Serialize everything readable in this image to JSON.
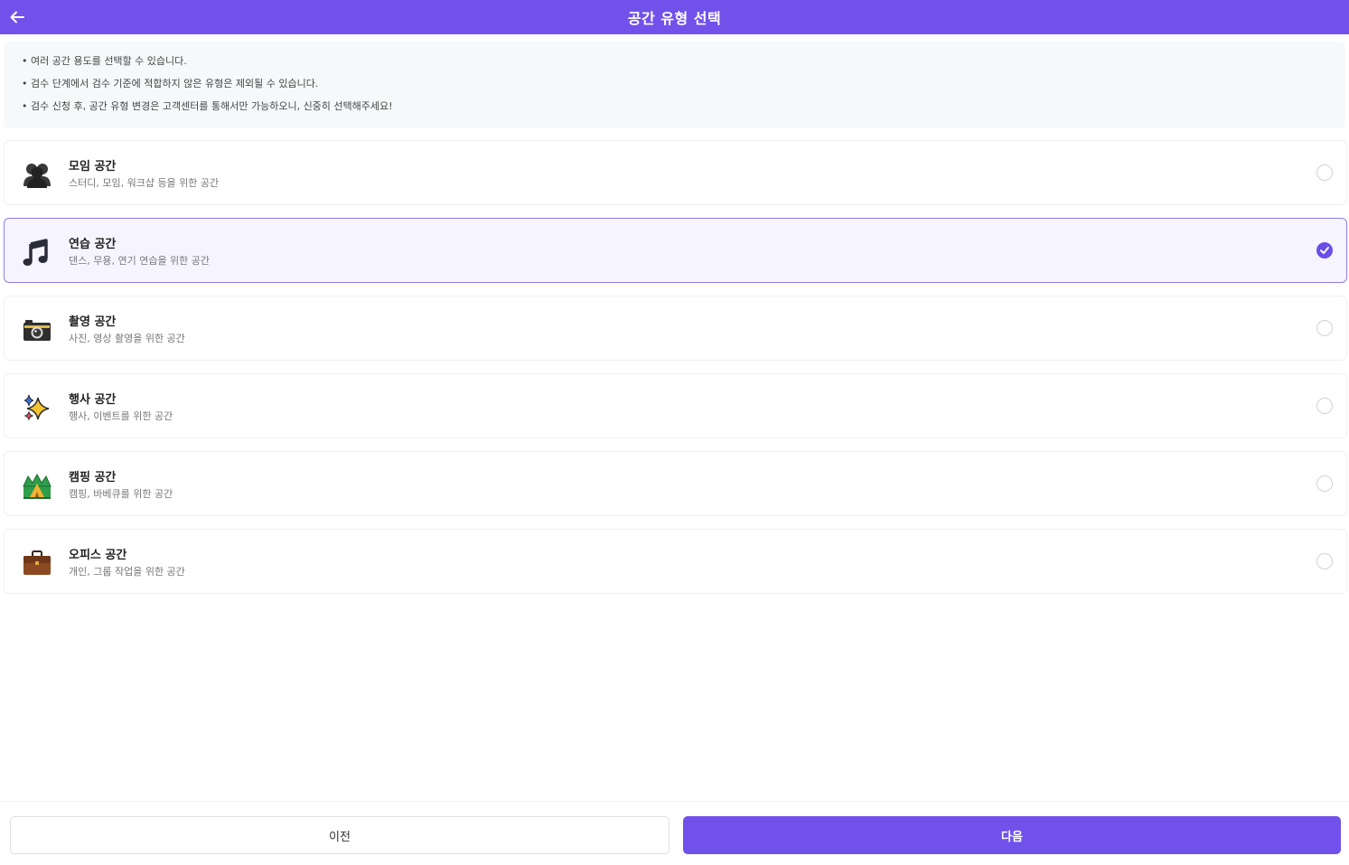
{
  "header": {
    "title": "공간 유형 선택",
    "back_icon": "arrow-left-icon"
  },
  "notice": {
    "lines": [
      "• 여러 공간 용도를 선택할 수 있습니다.",
      "• 검수 단계에서 검수 기준에 적합하지 않은 유형은 제외될 수 있습니다.",
      "• 검수 신청 후, 공간 유형 변경은 고객센터를 통해서만 가능하오니, 신중히 선택해주세요!"
    ]
  },
  "options": [
    {
      "title": "모임 공간",
      "desc": "스터디, 모임, 워크샵 등을 위한 공간",
      "icon": "people-icon",
      "selected": false
    },
    {
      "title": "연습 공간",
      "desc": "댄스, 무용, 연기 연습을 위한 공간",
      "icon": "music-note-icon",
      "selected": true
    },
    {
      "title": "촬영 공간",
      "desc": "사진, 영상 촬영을 위한 공간",
      "icon": "camera-icon",
      "selected": false
    },
    {
      "title": "행사 공간",
      "desc": "행사, 이벤트를 위한 공간",
      "icon": "sparkles-icon",
      "selected": false
    },
    {
      "title": "캠핑 공간",
      "desc": "캠핑, 바베큐를 위한 공간",
      "icon": "camping-icon",
      "selected": false
    },
    {
      "title": "오피스 공간",
      "desc": "개인, 그룹 작업을 위한 공간",
      "icon": "briefcase-icon",
      "selected": false
    }
  ],
  "footer": {
    "prev_label": "이전",
    "next_label": "다음"
  },
  "colors": {
    "accent": "#7052ea",
    "selected_border": "#8e7cf0",
    "selected_bg": "#f6f5ff",
    "notice_bg": "#f6f9fa"
  }
}
